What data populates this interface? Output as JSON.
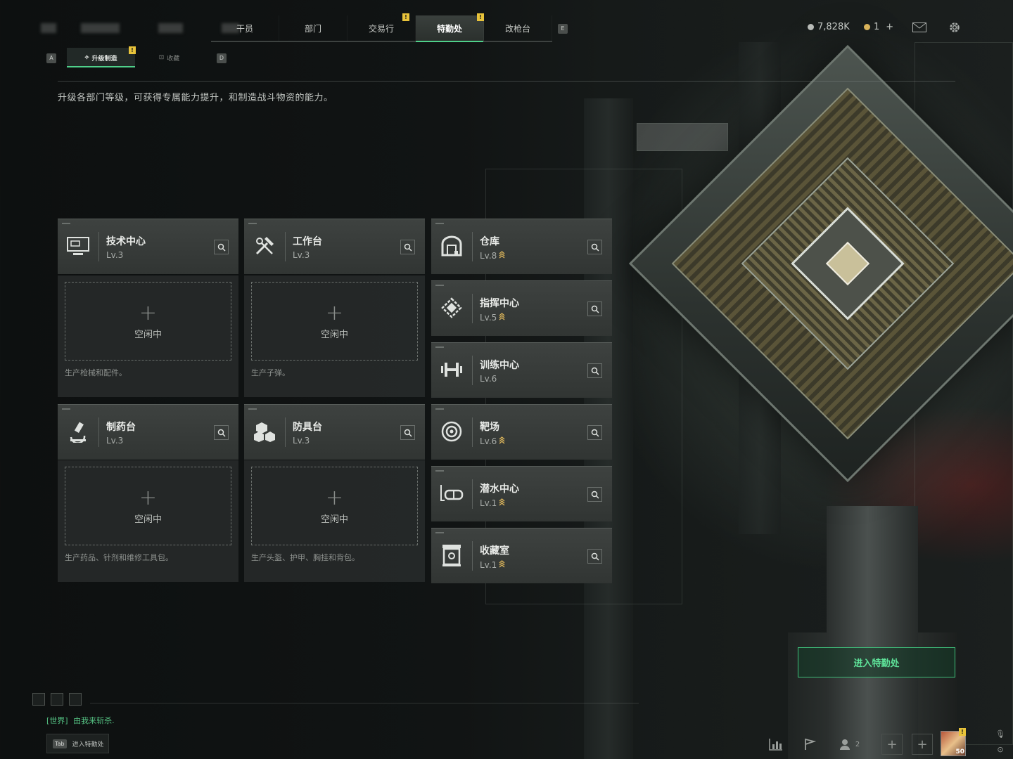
{
  "nav": {
    "tabs": [
      {
        "label": "干员",
        "badge": ""
      },
      {
        "label": "部门",
        "badge": ""
      },
      {
        "label": "交易行",
        "badge": "!"
      },
      {
        "label": "特勤处",
        "badge": "!"
      },
      {
        "label": "改枪台",
        "badge": ""
      }
    ],
    "key_left": "",
    "key_right": "E",
    "currency_primary": "7,828K",
    "currency_secondary": "1",
    "currency_add": "+"
  },
  "subnav": {
    "key_left": "A",
    "key_right": "D",
    "tabs": [
      {
        "label": "升级制造",
        "badge": "!"
      },
      {
        "label": "收藏",
        "badge": ""
      }
    ]
  },
  "description": "升级各部门等级，可获得专属能力提升，和制造战斗物资的能力。",
  "facilities": [
    {
      "name": "技术中心",
      "level": "Lv.3",
      "upgradable": false,
      "icon": "monitor-icon"
    },
    {
      "name": "工作台",
      "level": "Lv.3",
      "upgradable": false,
      "icon": "tools-icon"
    },
    {
      "name": "仓库",
      "level": "Lv.8",
      "upgradable": true,
      "icon": "warehouse-icon"
    },
    {
      "name": "指挥中心",
      "level": "Lv.5",
      "upgradable": true,
      "icon": "command-icon"
    },
    {
      "name": "训练中心",
      "level": "Lv.6",
      "upgradable": false,
      "icon": "dumbbell-icon"
    },
    {
      "name": "制药台",
      "level": "Lv.3",
      "upgradable": false,
      "icon": "microscope-icon"
    },
    {
      "name": "防具台",
      "level": "Lv.3",
      "upgradable": false,
      "icon": "armor-icon"
    },
    {
      "name": "靶场",
      "level": "Lv.6",
      "upgradable": true,
      "icon": "target-icon"
    },
    {
      "name": "潜水中心",
      "level": "Lv.1",
      "upgradable": true,
      "icon": "diving-icon"
    },
    {
      "name": "收藏室",
      "level": "Lv.1",
      "upgradable": true,
      "icon": "collection-icon"
    }
  ],
  "production_slots": [
    {
      "status": "空闲中",
      "description": "生产枪械和配件。"
    },
    {
      "status": "空闲中",
      "description": "生产子弹。"
    },
    {
      "status": "空闲中",
      "description": "生产药品、针剂和维修工具包。"
    },
    {
      "status": "空闲中",
      "description": "生产头盔、护甲、胸挂和背包。"
    }
  ],
  "enter_button": "进入特勤处",
  "chat": {
    "channel": "[世界]",
    "text": "由我来斩杀."
  },
  "tab_hint": {
    "key": "Tab",
    "label": "进入特勤处"
  },
  "bottom": {
    "friends_count": "2",
    "avatar_level": "50",
    "avatar_badge": "!"
  },
  "colors": {
    "accent": "#4fd08a",
    "badge": "#e8c33a",
    "upgrade": "#d9b35a"
  }
}
